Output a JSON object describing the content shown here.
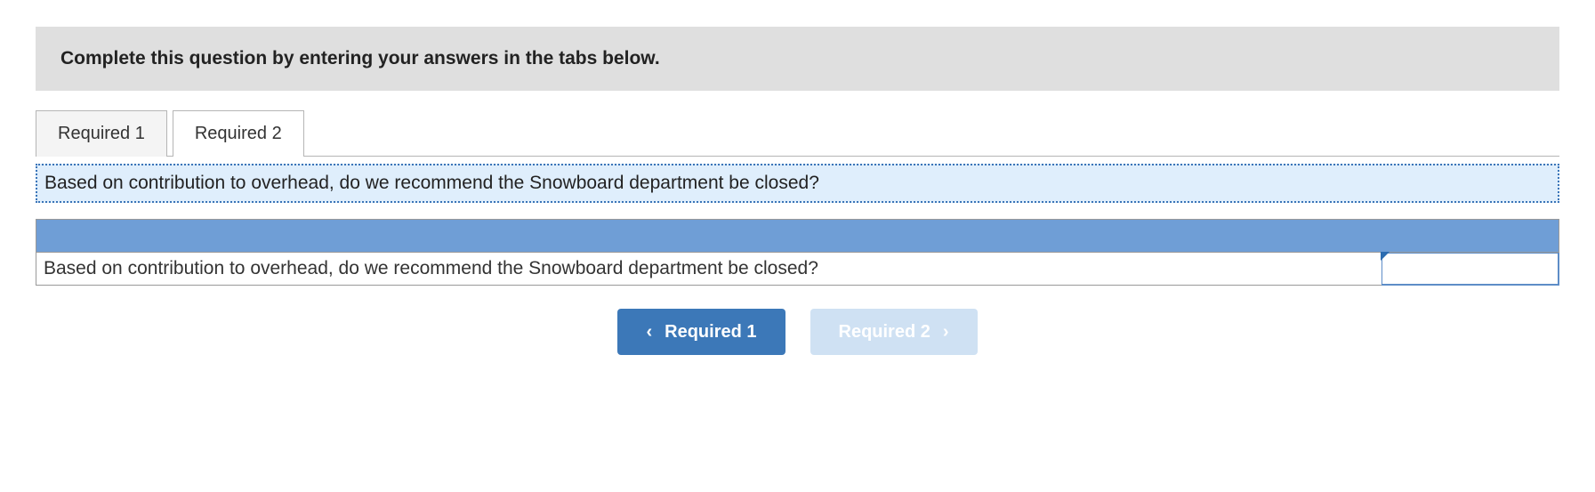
{
  "instruction": "Complete this question by entering your answers in the tabs below.",
  "tabs": {
    "items": [
      {
        "label": "Required 1",
        "active": false
      },
      {
        "label": "Required 2",
        "active": true
      }
    ]
  },
  "question": {
    "prompt": "Based on contribution to overhead, do we recommend the Snowboard department be closed?"
  },
  "answer": {
    "row_label": "Based on contribution to overhead, do we recommend the Snowboard department be closed?",
    "value": ""
  },
  "nav": {
    "prev": {
      "label": "Required 1",
      "chevron": "‹"
    },
    "next": {
      "label": "Required 2",
      "chevron": "›"
    }
  }
}
